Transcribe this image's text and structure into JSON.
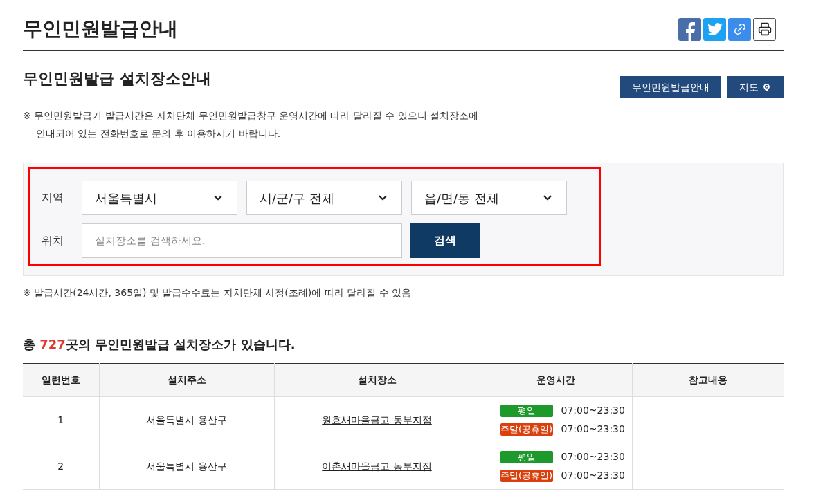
{
  "page_title": "무인민원발급안내",
  "share_icons": [
    {
      "kind": "facebook"
    },
    {
      "kind": "twitter"
    },
    {
      "kind": "link"
    },
    {
      "kind": "print"
    }
  ],
  "section_title": "무인민원발급 설치장소안내",
  "header_buttons": [
    {
      "label": "무인민원발급안내",
      "kind": "text"
    },
    {
      "label": "지도",
      "kind": "map"
    }
  ],
  "notice": [
    "※ 무인민원발급기 발급시간은 자치단체 무인민원발급창구 운영시간에 따라 달라질 수 있으니 설치장소에",
    "안내되어 있는 전화번호로 문의 후 이용하시기 바랍니다."
  ],
  "search": {
    "region_label": "지역",
    "selects": [
      "서울특별시",
      "시/군/구 전체",
      "읍/면/동 전체"
    ],
    "location_label": "위치",
    "placeholder": "설치장소를 검색하세요.",
    "button": "검색"
  },
  "footnote": "※ 발급시간(24시간, 365일) 및 발급수수료는 자치단체 사정(조례)에 따라 달라질 수 있음",
  "summary": {
    "prefix": "총 ",
    "count": "727",
    "suffix": "곳의 무인민원발급 설치장소가 있습니다."
  },
  "table": {
    "columns": [
      "일련번호",
      "설치주소",
      "설치장소",
      "운영시간",
      "참고내용"
    ],
    "rows": [
      {
        "no": "1",
        "address": "서울특별시 용산구",
        "place": "원효새마을금고 동부지점",
        "hours": [
          {
            "kind": "weekday",
            "tag": "평일",
            "time": "07:00~23:30"
          },
          {
            "kind": "weekend",
            "tag": "주말(공휴일)",
            "time": "07:00~23:30"
          }
        ]
      },
      {
        "no": "2",
        "address": "서울특별시 용산구",
        "place": "이촌새마을금고 동부지점",
        "hours": [
          {
            "kind": "weekday",
            "tag": "평일",
            "time": "07:00~23:30"
          },
          {
            "kind": "weekend",
            "tag": "주말(공휴일)",
            "time": "07:00~23:30"
          }
        ]
      }
    ]
  }
}
